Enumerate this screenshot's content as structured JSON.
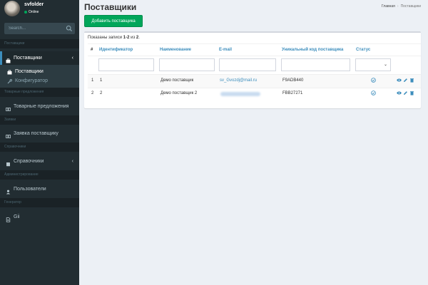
{
  "user": {
    "name": "svfolder",
    "status": "Online"
  },
  "search": {
    "placeholder": "Search..."
  },
  "sidebar": {
    "headers": [
      "Поставщики",
      "Товарные предложения",
      "Заявки",
      "Справочники",
      "Администрирование",
      "Генератор"
    ],
    "items": [
      {
        "label": "Поставщики",
        "icon": "briefcase-icon"
      },
      {
        "label": "Поставщики",
        "icon": "briefcase-icon"
      },
      {
        "label": "Конфигуратор",
        "icon": "wrench-icon"
      },
      {
        "label": "Товарные предложения",
        "icon": "grid-icon"
      },
      {
        "label": "Заявка поставщику",
        "icon": "grid-icon"
      },
      {
        "label": "Справочники",
        "icon": "book-icon"
      },
      {
        "label": "Пользователи",
        "icon": "user-icon"
      },
      {
        "label": "Gii",
        "icon": "file-icon"
      }
    ]
  },
  "page": {
    "title": "Поставщики"
  },
  "breadcrumb": {
    "home": "Главная",
    "current": "Поставщики"
  },
  "toolbar": {
    "add_label": "Добавить поставщика"
  },
  "summary": {
    "prefix": "Показаны записи ",
    "range": "1-2",
    "middle": " из ",
    "total": "2",
    "suffix": "."
  },
  "table": {
    "headers": [
      "#",
      "Идентификатор",
      "Наименование",
      "E-mail",
      "Уникальный код поставщика",
      "Статус"
    ],
    "rows": [
      {
        "num": "1",
        "id": "1",
        "name": "Демо поставщик",
        "email": "sv_Gvozdj@mail.ru",
        "code": "F9ADB440"
      },
      {
        "num": "2",
        "id": "2",
        "name": "Демо поставщик 2",
        "email": "",
        "code": "FBB27271"
      }
    ]
  },
  "colors": {
    "sidebar": "#222d32",
    "accent": "#3c8dbc",
    "success": "#00a65a",
    "background": "#ecf0f5"
  }
}
